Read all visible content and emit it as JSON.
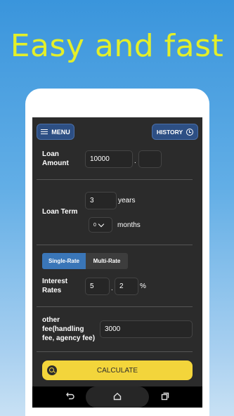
{
  "promo_title": "Easy and fast",
  "toolbar": {
    "menu_label": "MENU",
    "history_label": "HISTORY"
  },
  "loan_amount": {
    "label_line1": "Loan",
    "label_line2": "Amount",
    "integer_value": "10000",
    "separator": ".",
    "decimal_value": ""
  },
  "loan_term": {
    "label": "Loan Term",
    "years_value": "3",
    "years_unit": "years",
    "months_value": "0",
    "months_unit": "months"
  },
  "rate_tabs": {
    "single": "Single-Rate",
    "multi": "Multi-Rate"
  },
  "interest": {
    "label_line1": "Interest",
    "label_line2": "Rates",
    "integer_value": "5",
    "separator": ".",
    "decimal_value": "2",
    "unit": "%"
  },
  "other_fee": {
    "label_line1": "other",
    "label_line2": "fee(handling",
    "label_line3": "fee, agency fee)",
    "value": "3000"
  },
  "calculate_label": "CALCULATE",
  "icons": {
    "menu": "hamburger-icon",
    "history": "clock-icon",
    "calculate": "search-icon",
    "back": "back-icon",
    "home": "home-icon",
    "recents": "recents-icon"
  },
  "colors": {
    "accent_blue": "#3a76b8",
    "button_blue": "#2d4f84",
    "calculate_yellow": "#f3d53b",
    "promo_text": "#e3ef2a",
    "screen_bg": "#2b2b2b"
  }
}
